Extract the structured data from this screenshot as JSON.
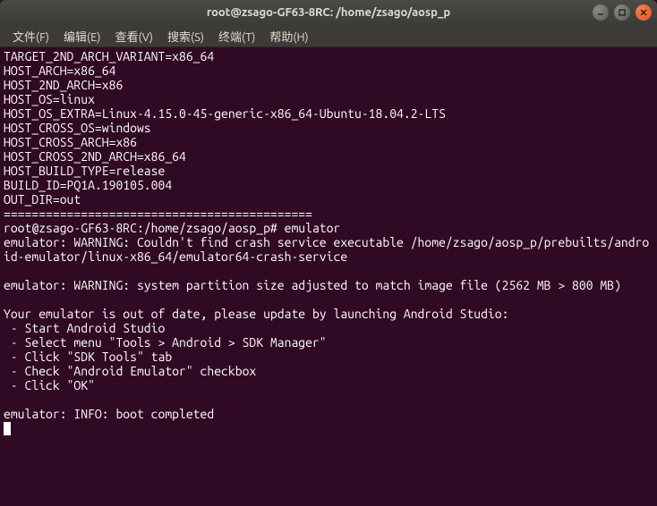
{
  "window": {
    "title": "root@zsago-GF63-8RC: /home/zsago/aosp_p"
  },
  "menu": {
    "file": "文件(F)",
    "edit": "编辑(E)",
    "view": "查看(V)",
    "search": "搜索(S)",
    "terminal": "终端(T)",
    "help": "帮助(H)"
  },
  "icons": {
    "min": "minimize-icon",
    "max": "maximize-icon",
    "close": "close-icon"
  },
  "terminal": {
    "lines": [
      "TARGET_2ND_ARCH_VARIANT=x86_64",
      "HOST_ARCH=x86_64",
      "HOST_2ND_ARCH=x86",
      "HOST_OS=linux",
      "HOST_OS_EXTRA=Linux-4.15.0-45-generic-x86_64-Ubuntu-18.04.2-LTS",
      "HOST_CROSS_OS=windows",
      "HOST_CROSS_ARCH=x86",
      "HOST_CROSS_2ND_ARCH=x86_64",
      "HOST_BUILD_TYPE=release",
      "BUILD_ID=PQ1A.190105.004",
      "OUT_DIR=out",
      "============================================",
      "root@zsago-GF63-8RC:/home/zsago/aosp_p# emulator",
      "emulator: WARNING: Couldn't find crash service executable /home/zsago/aosp_p/prebuilts/android-emulator/linux-x86_64/emulator64-crash-service",
      "",
      "emulator: WARNING: system partition size adjusted to match image file (2562 MB > 800 MB)",
      "",
      "Your emulator is out of date, please update by launching Android Studio:",
      " - Start Android Studio",
      " - Select menu \"Tools > Android > SDK Manager\"",
      " - Click \"SDK Tools\" tab",
      " - Check \"Android Emulator\" checkbox",
      " - Click \"OK\"",
      "",
      "emulator: INFO: boot completed"
    ]
  }
}
